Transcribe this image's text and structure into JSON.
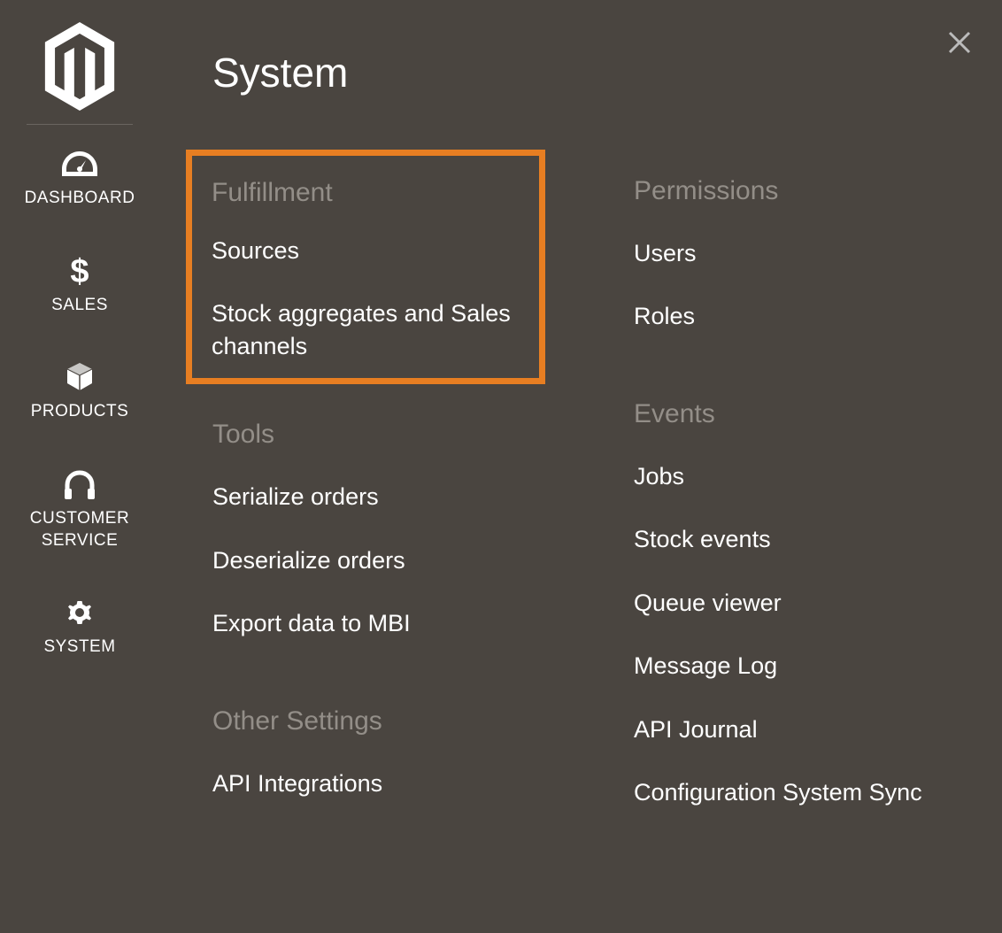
{
  "page_title": "System",
  "sidebar": {
    "items": [
      {
        "label": "DASHBOARD",
        "icon": "dashboard"
      },
      {
        "label": "SALES",
        "icon": "dollar"
      },
      {
        "label": "PRODUCTS",
        "icon": "box"
      },
      {
        "label": "CUSTOMER SERVICE",
        "icon": "headphones"
      },
      {
        "label": "SYSTEM",
        "icon": "gear"
      }
    ]
  },
  "columns": {
    "left": [
      {
        "header": "Fulfillment",
        "highlighted": true,
        "items": [
          "Sources",
          "Stock aggregates and Sales channels"
        ]
      },
      {
        "header": "Tools",
        "items": [
          "Serialize orders",
          "Deserialize orders",
          "Export data to MBI"
        ]
      },
      {
        "header": "Other Settings",
        "items": [
          "API Integrations"
        ]
      }
    ],
    "right": [
      {
        "header": "Permissions",
        "items": [
          "Users",
          "Roles"
        ]
      },
      {
        "header": "Events",
        "items": [
          "Jobs",
          "Stock events",
          "Queue viewer",
          "Message Log",
          "API Journal",
          "Configuration System Sync"
        ]
      }
    ]
  }
}
